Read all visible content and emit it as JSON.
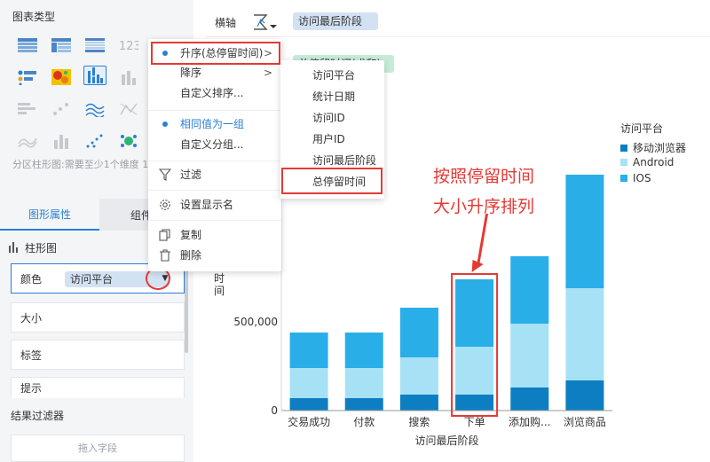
{
  "left_panel": {
    "chart_type_title": "图表类型",
    "chart_type_icons": [
      "table-icon",
      "crosstab-icon",
      "detail-table-icon",
      "number-123-icon",
      "bar-chart-icon",
      "stacked-bar-icon",
      "bar-icon-3",
      "bar-icon-4",
      "scatter-icon",
      "heatmap-icon",
      "grouped-bar-icon",
      "histogram-icon",
      "combo-icon",
      "line-icon-2",
      "wave-icon",
      "xy-icon",
      "area-icon",
      "bar-icon-5",
      "dot-icon",
      "bubble-icon"
    ],
    "type_hint": "分区柱形图:需要至少1个维度 1个指标",
    "tab_graphic": "图形属性",
    "tab_component": "组件样",
    "bar_type_label": "柱形图",
    "color_label": "颜色",
    "color_value": "访问平台",
    "size_label": "大小",
    "label_label": "标签",
    "tooltip_label": "提示",
    "filter_title": "结果过滤器",
    "filter_drop": "拖入字段"
  },
  "axis_row": {
    "label": "横轴",
    "pill": "访问最后阶段"
  },
  "value_row": {
    "pill": "总停留时间(求和)"
  },
  "context_menu": {
    "asc": "升序(总停留时间)",
    "desc": "降序",
    "custom_sort": "自定义排序...",
    "same_value_group": "相同值为一组",
    "custom_group": "自定义分组...",
    "filter": "过滤",
    "set_display_name": "设置显示名",
    "copy": "复制",
    "delete": "删除"
  },
  "sub_menu": [
    "访问平台",
    "统计日期",
    "访问ID",
    "用户ID",
    "访问最后阶段",
    "总停留时间"
  ],
  "annotation": {
    "line1": "按照停留时间",
    "line2": "大小升序排列"
  },
  "colors": {
    "accent": "#2a7fd4",
    "highlight": "#e53935",
    "mobile": "#0e7ec2",
    "android": "#a7e1f6",
    "ios": "#29aee8"
  },
  "chart_data": {
    "type": "bar",
    "stacked": true,
    "categories": [
      "交易成功",
      "付款",
      "搜索",
      "下单",
      "添加购...",
      "浏览商品"
    ],
    "series": [
      {
        "name": "移动浏览器",
        "values": [
          70000,
          70000,
          90000,
          90000,
          130000,
          170000
        ]
      },
      {
        "name": "Android",
        "values": [
          170000,
          170000,
          210000,
          270000,
          360000,
          520000
        ]
      },
      {
        "name": "IOS",
        "values": [
          200000,
          200000,
          280000,
          380000,
          380000,
          640000
        ]
      }
    ],
    "xlabel": "访问最后阶段",
    "ylabel": "时间",
    "yticks": [
      "0",
      "500,000"
    ],
    "ylim": [
      0,
      1500000
    ],
    "legend_title": "访问平台",
    "legend_position": "right"
  }
}
